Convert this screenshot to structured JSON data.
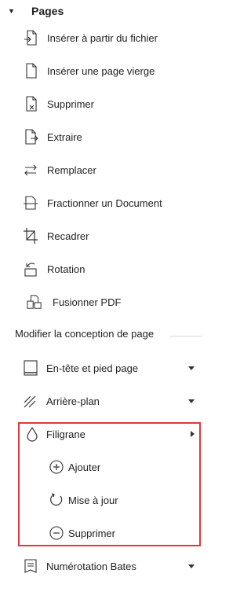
{
  "section": {
    "title": "Pages"
  },
  "pages_items": [
    {
      "label": "Insérer à partir du fichier",
      "icon": "insert-from-file-icon"
    },
    {
      "label": "Insérer une page vierge",
      "icon": "insert-blank-page-icon"
    },
    {
      "label": "Supprimer",
      "icon": "delete-page-icon"
    },
    {
      "label": "Extraire",
      "icon": "extract-page-icon"
    },
    {
      "label": "Remplacer",
      "icon": "replace-page-icon"
    },
    {
      "label": "Fractionner un Document",
      "icon": "split-document-icon"
    },
    {
      "label": "Recadrer",
      "icon": "crop-icon"
    },
    {
      "label": "Rotation",
      "icon": "rotate-icon"
    },
    {
      "label": "Fusionner PDF",
      "icon": "merge-pdf-icon"
    }
  ],
  "design_section": {
    "label": "Modifier la conception de page"
  },
  "design_items": {
    "header_footer": {
      "label": "En-tête et pied page",
      "icon": "header-footer-icon"
    },
    "background": {
      "label": "Arrière-plan",
      "icon": "background-icon"
    },
    "watermark": {
      "label": "Filigrane",
      "icon": "watermark-drop-icon",
      "children": [
        {
          "label": "Ajouter",
          "icon": "add-circle-icon"
        },
        {
          "label": "Mise à jour",
          "icon": "update-refresh-icon"
        },
        {
          "label": "Supprimer",
          "icon": "remove-circle-icon"
        }
      ]
    },
    "bates": {
      "label": "Numérotation Bates",
      "icon": "bates-numbering-icon"
    }
  },
  "colors": {
    "highlight": "#e0383e",
    "text": "#222222",
    "divider": "#d8d8d8"
  }
}
